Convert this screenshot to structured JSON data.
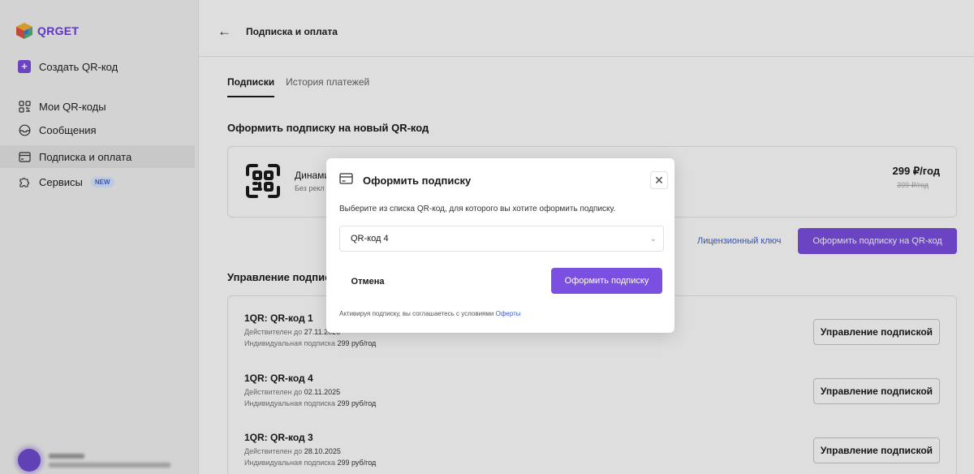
{
  "app": {
    "logo_text": "QRGET"
  },
  "sidebar": {
    "items": [
      {
        "label": "Создать QR-код",
        "icon": "plus-icon"
      },
      {
        "label": "Мои QR-коды",
        "icon": "qr-grid-icon"
      },
      {
        "label": "Сообщения",
        "icon": "inbox-icon"
      },
      {
        "label": "Подписка и оплата",
        "icon": "card-icon",
        "active": true
      },
      {
        "label": "Сервисы",
        "icon": "puzzle-icon",
        "badge": "NEW"
      }
    ]
  },
  "header": {
    "title": "Подписка и оплата"
  },
  "tabs": [
    {
      "label": "Подписки",
      "active": true
    },
    {
      "label": "История платежей",
      "active": false
    }
  ],
  "new_subscription": {
    "section_title": "Оформить подписку на новый QR-код",
    "card_name": "Динами",
    "card_sub": "Без рекл",
    "price": "299 ₽/год",
    "price_old": "399 ₽/год",
    "license_link": "Лицензионный ключ",
    "subscribe_button": "Оформить подписку на QR-код"
  },
  "manage": {
    "section_title": "Управление подпис",
    "rows": [
      {
        "title": "1QR: QR-код 1",
        "valid_prefix": "Действителен до",
        "valid_date": "27.11.2026",
        "plan_prefix": "Индивидуальная подписка",
        "plan_price": "299 руб/год",
        "button": "Управление подпиской"
      },
      {
        "title": "1QR: QR-код 4",
        "valid_prefix": "Действителен до",
        "valid_date": "02.11.2025",
        "plan_prefix": "Индивидуальная подписка",
        "plan_price": "299 руб/год",
        "button": "Управление подпиской"
      },
      {
        "title": "1QR: QR-код 3",
        "valid_prefix": "Действителен до",
        "valid_date": "28.10.2025",
        "plan_prefix": "Индивидуальная подписка",
        "plan_price": "299 руб/год",
        "button": "Управление подпиской"
      }
    ]
  },
  "modal": {
    "title": "Оформить подписку",
    "description": "Выберите из списка QR-код, для которого вы хотите оформить подписку.",
    "select_value": "QR-код 4",
    "cancel": "Отмена",
    "confirm": "Оформить подписку",
    "terms_text": "Активируя подписку, вы соглашаетесь с условиями",
    "terms_link": "Оферты"
  },
  "colors": {
    "accent": "#7b4fe0",
    "link": "#3c5ccb"
  }
}
